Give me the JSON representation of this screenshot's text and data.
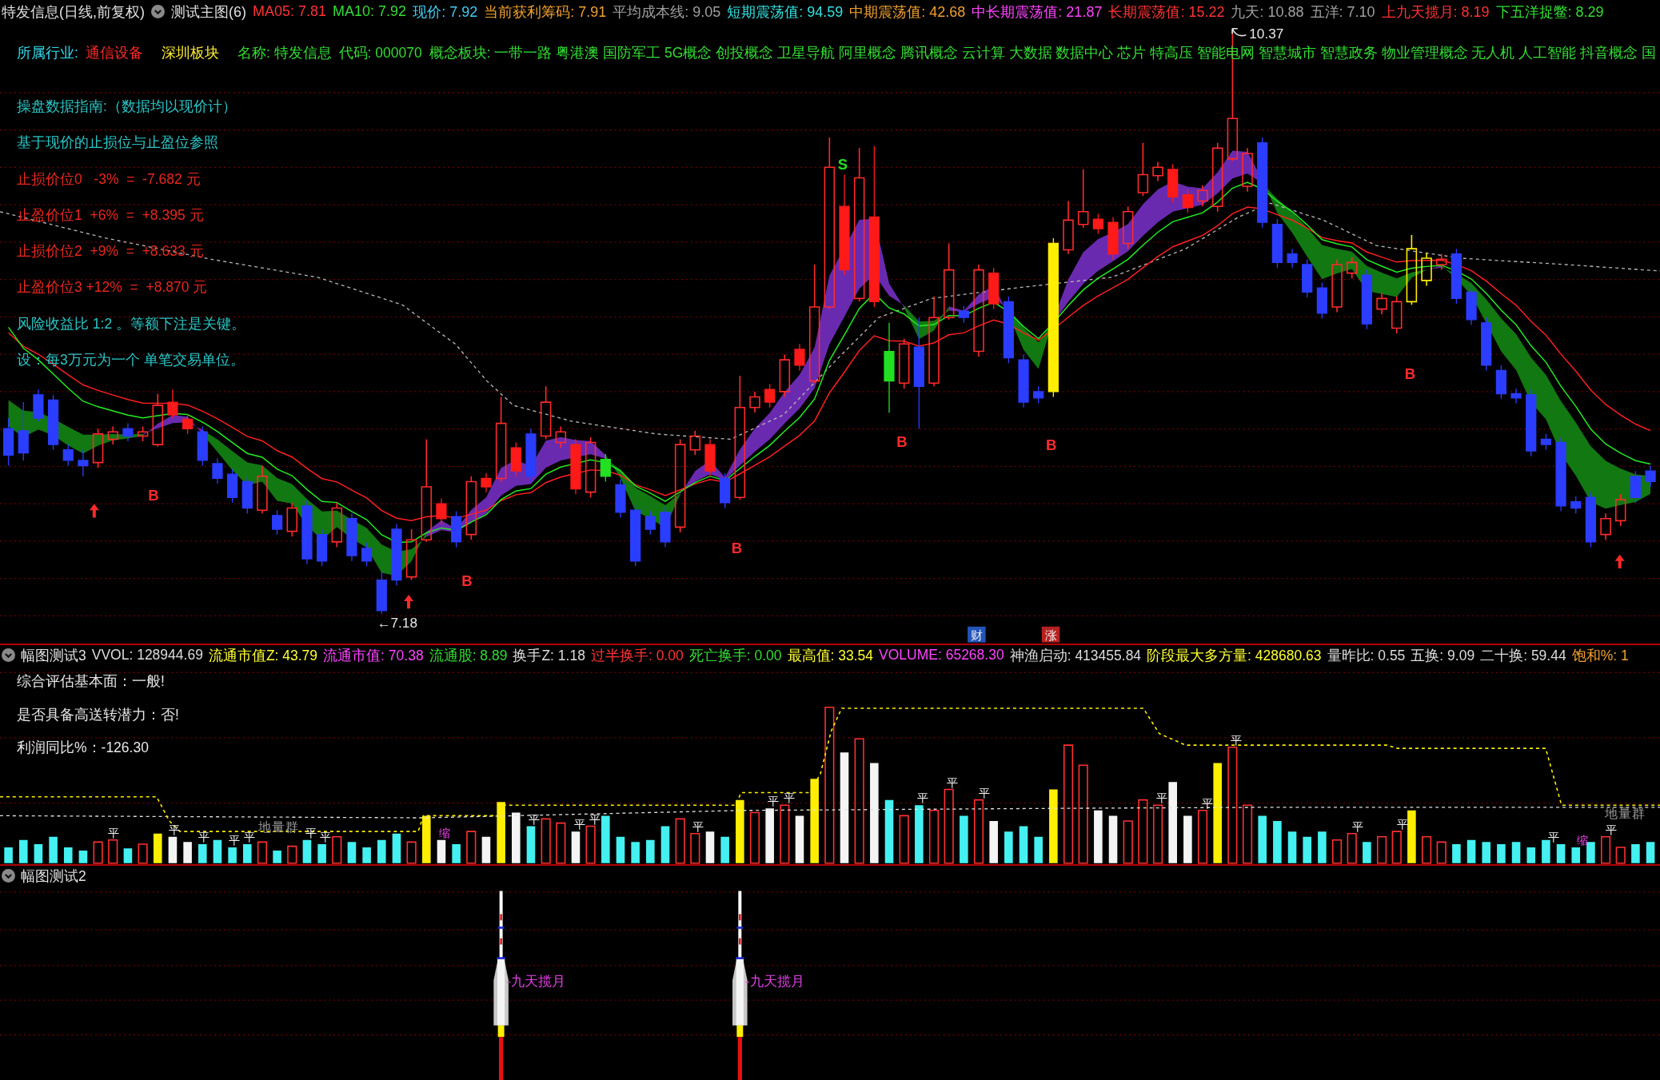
{
  "main_panel": {
    "stock_title": "特发信息(日线,前复权)",
    "indicator_name": "测试主图(6)",
    "readings": [
      {
        "text": "MA05: 7.81",
        "color": "#ff3333"
      },
      {
        "text": "MA10: 7.92",
        "color": "#33dd33"
      },
      {
        "text": "现价: 7.92",
        "color": "#44ccee"
      },
      {
        "text": "当前获利筹码: 7.91",
        "color": "#f0a030"
      },
      {
        "text": "平均成本线: 9.05",
        "color": "#a0a0a0"
      },
      {
        "text": "短期震荡值: 94.59",
        "color": "#33e0e0"
      },
      {
        "text": "中期震荡值: 42.68",
        "color": "#f0a030"
      },
      {
        "text": "中长期震荡值: 21.87",
        "color": "#ff44ff"
      },
      {
        "text": "长期震荡值: 15.22",
        "color": "#ff3333"
      },
      {
        "text": "九天: 10.88",
        "color": "#a0a0a0"
      },
      {
        "text": "五洋: 7.10",
        "color": "#a0a0a0"
      },
      {
        "text": "上九天揽月: 8.19",
        "color": "#ff3333"
      },
      {
        "text": "下五洋捉鳖: 8.29",
        "color": "#33dd33"
      }
    ],
    "info_line": {
      "industry_label": "所属行业:",
      "industry": "通信设备",
      "region": "深圳板块",
      "stock_name": "名称: 特发信息",
      "stock_code": "代码: 000070",
      "concepts": "概念板块: 一带一路 粤港澳 国防军工 5G概念 创投概念 卫星导航 阿里概念 腾讯概念 云计算 大数据 数据中心 芯片 特高压 智能电网 智慧城市 智慧政务 物业管理概念 无人机 人工智能 抖音概念 国"
    },
    "guide": [
      {
        "kind": "note",
        "text": "操盘数据指南:（数据均以现价计）"
      },
      {
        "kind": "note",
        "text": "基于现价的止损位与止盈位参照"
      },
      {
        "kind": "level",
        "text": "止损价位0   -3%  =  -7.682 元"
      },
      {
        "kind": "level",
        "text": "止盈价位1  +6%  =  +8.395 元"
      },
      {
        "kind": "level",
        "text": "止损价位2  +9%  =  +8.633 元"
      },
      {
        "kind": "level",
        "text": "止盈价位3 +12%  =  +8.870 元"
      },
      {
        "kind": "note",
        "text": "风险收益比 1:2 。等额下注是关键。"
      },
      {
        "kind": "note",
        "text": "设：每3万元为一个 单笔交易单位。"
      }
    ],
    "signals": [
      {
        "kind": "buy",
        "text": "B"
      },
      {
        "kind": "buy",
        "text": "B"
      },
      {
        "kind": "buy",
        "text": "B"
      },
      {
        "kind": "sell",
        "text": "S"
      },
      {
        "kind": "buy",
        "text": "B"
      },
      {
        "kind": "buy",
        "text": "B"
      },
      {
        "kind": "buy",
        "text": "B"
      }
    ],
    "price_labels": [
      {
        "text": "←7.18"
      },
      {
        "text": "10.37"
      }
    ],
    "event_badges": [
      {
        "kind": "finance",
        "text": "财"
      },
      {
        "kind": "rise",
        "text": "涨"
      }
    ]
  },
  "volume_panel": {
    "title": "幅图测试3",
    "readings": [
      {
        "text": "VVOL: 128944.69",
        "color": "#dcdcdc"
      },
      {
        "text": "流通市值Z: 43.79",
        "color": "#ffff33"
      },
      {
        "text": "流通市值: 70.38",
        "color": "#ff44ff"
      },
      {
        "text": "流通股: 8.89",
        "color": "#33dd33"
      },
      {
        "text": "换手Z: 1.18",
        "color": "#dcdcdc"
      },
      {
        "text": "过半换手: 0.00",
        "color": "#ff3333"
      },
      {
        "text": "死亡换手: 0.00",
        "color": "#33dd33"
      },
      {
        "text": "最高值: 33.54",
        "color": "#ffff33"
      },
      {
        "text": "VOLUME: 65268.30",
        "color": "#ff44ff"
      },
      {
        "text": "神渔启动: 413455.84",
        "color": "#dcdcdc"
      },
      {
        "text": "阶段最大多方量: 428680.63",
        "color": "#ffff33"
      },
      {
        "text": "量昨比: 0.55",
        "color": "#dcdcdc"
      },
      {
        "text": "五换: 9.09",
        "color": "#dcdcdc"
      },
      {
        "text": "二十换: 59.44",
        "color": "#dcdcdc"
      },
      {
        "text": "饱和%: 1",
        "color": "#f0a030"
      }
    ],
    "notes": [
      "综合评估基本面：一般!",
      "是否具备高送转潜力：否!",
      "利润同比%：-126.30"
    ],
    "zone_labels": [
      "地量群",
      "地量群"
    ],
    "bar_marks": [
      {
        "kind": "flat",
        "text": "平"
      },
      {
        "kind": "flat",
        "text": "平"
      },
      {
        "kind": "flat",
        "text": "平"
      },
      {
        "kind": "flat",
        "text": "平"
      },
      {
        "kind": "flat",
        "text": "平"
      },
      {
        "kind": "flat",
        "text": "平"
      },
      {
        "kind": "flat",
        "text": "平"
      },
      {
        "kind": "shrink",
        "text": "缩"
      },
      {
        "kind": "flat",
        "text": "平"
      },
      {
        "kind": "flat",
        "text": "平"
      },
      {
        "kind": "flat",
        "text": "平"
      },
      {
        "kind": "flat",
        "text": "平"
      },
      {
        "kind": "flat",
        "text": "平"
      },
      {
        "kind": "flat",
        "text": "平"
      },
      {
        "kind": "flat",
        "text": "平"
      },
      {
        "kind": "flat",
        "text": "平"
      },
      {
        "kind": "flat",
        "text": "平"
      },
      {
        "kind": "flat",
        "text": "平"
      },
      {
        "kind": "flat",
        "text": "平"
      },
      {
        "kind": "flat",
        "text": "平"
      },
      {
        "kind": "flat",
        "text": "平"
      },
      {
        "kind": "flat",
        "text": "平"
      },
      {
        "kind": "flat",
        "text": "平"
      },
      {
        "kind": "shrink",
        "text": "缩"
      },
      {
        "kind": "flat",
        "text": "平"
      }
    ]
  },
  "sub_panel": {
    "title": "幅图测试2",
    "signals": [
      {
        "text": "-九天揽月"
      },
      {
        "text": "-九天揽月"
      }
    ]
  }
}
